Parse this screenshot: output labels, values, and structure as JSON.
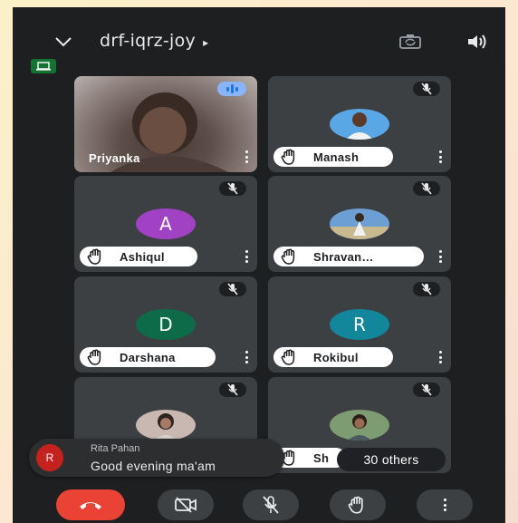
{
  "meeting": {
    "code": "drf-iqrz-joy",
    "title_caret": "▸"
  },
  "participants": [
    {
      "name": "Priyanka",
      "avatar_letter": "",
      "avatar_color": "",
      "speaking": true,
      "video": true
    },
    {
      "name": "Manash",
      "avatar_letter": "",
      "avatar_color": "#5aa7e6",
      "speaking": false,
      "video": false
    },
    {
      "name": "Ashiqul",
      "avatar_letter": "A",
      "avatar_color": "#a142c4",
      "speaking": false,
      "video": false
    },
    {
      "name": "Shravan…",
      "avatar_letter": "",
      "avatar_color": "#6c9fd4",
      "speaking": false,
      "video": false
    },
    {
      "name": "Darshana",
      "avatar_letter": "D",
      "avatar_color": "#0e6b4a",
      "speaking": false,
      "video": false
    },
    {
      "name": "Rokibul",
      "avatar_letter": "R",
      "avatar_color": "#12869b",
      "speaking": false,
      "video": false
    },
    {
      "name": "",
      "avatar_letter": "",
      "avatar_color": "#c9b7b2",
      "speaking": false,
      "video": false
    },
    {
      "name": "Sh",
      "avatar_letter": "",
      "avatar_color": "#7e9c72",
      "speaking": false,
      "video": false
    }
  ],
  "chat_toast": {
    "avatar_letter": "R",
    "sender": "Rita Pahan",
    "message": "Good evening ma'am"
  },
  "others_badge": "30 others",
  "icons": {
    "collapse": "chevron-down-icon",
    "camera_switch": "camera-switch-icon",
    "speaker": "speaker-icon",
    "cast": "cast-icon",
    "mic_off": "mic-off-icon",
    "raise_hand": "raise-hand-icon",
    "more": "more-vert-icon",
    "end_call": "end-call-icon",
    "video_off": "video-off-icon"
  },
  "colors": {
    "end_call": "#ea4335",
    "control_bg": "#3c4043",
    "tile_bg": "#3c4043",
    "cast_badge": "#137333"
  }
}
